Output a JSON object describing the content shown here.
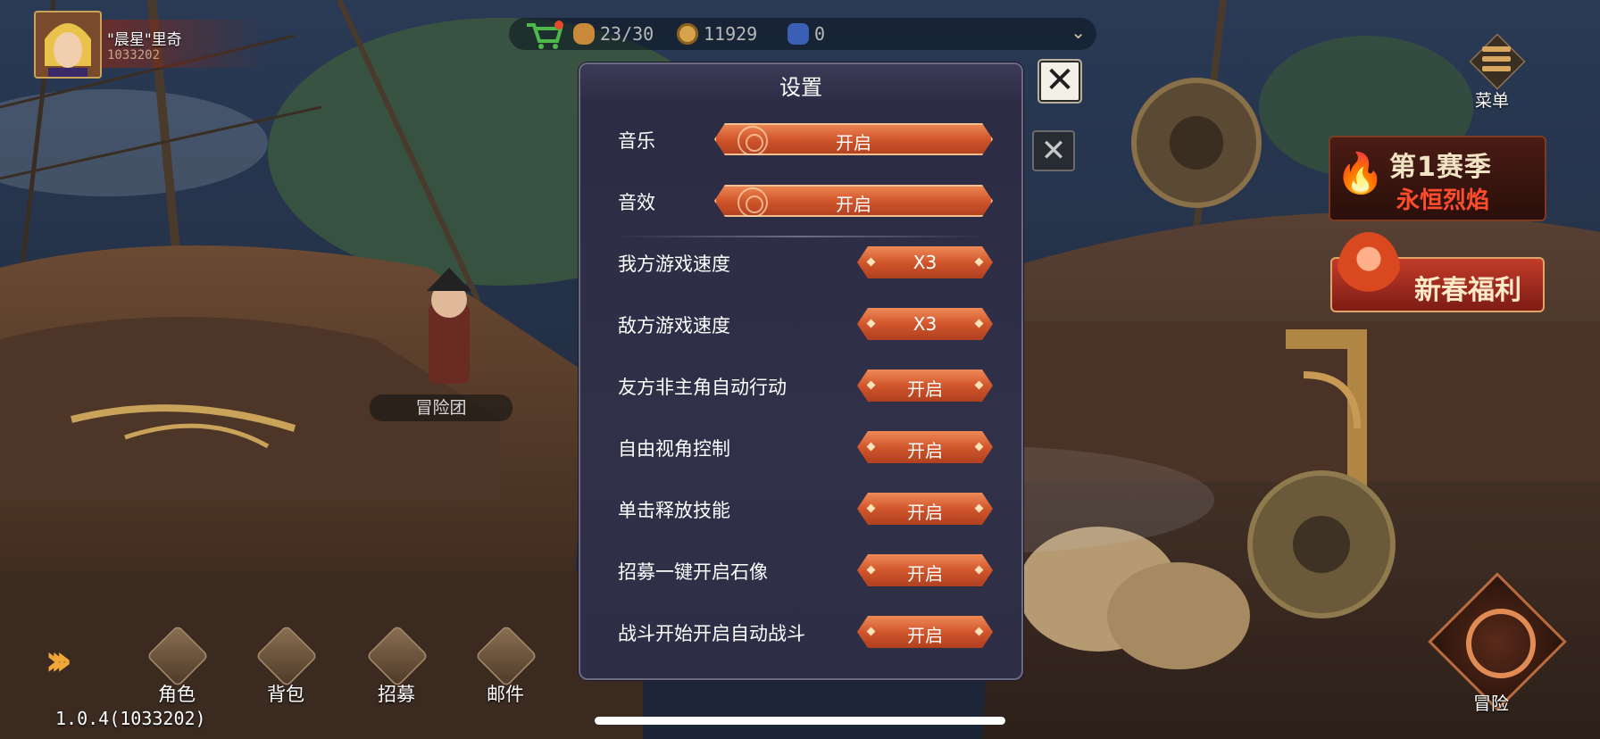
{
  "player": {
    "name": "\"晨星\"里奇",
    "id": "1033202"
  },
  "resources": [
    {
      "name": "stamina",
      "value": "23/30",
      "color": "#c88a3a",
      "icon": "bread-icon"
    },
    {
      "name": "gold",
      "value": "11929",
      "color": "#d6a24a",
      "icon": "coin-icon"
    },
    {
      "name": "gem",
      "value": "0",
      "color": "#3a5fb5",
      "icon": "gem-icon"
    }
  ],
  "menu": {
    "label": "菜单"
  },
  "season_banner": {
    "line1": "第1赛季",
    "line2": "永恒烈焰"
  },
  "new_year_banner": {
    "label": "新春福利"
  },
  "adventure": {
    "label": "冒险"
  },
  "adventure_team": {
    "label": "冒险团"
  },
  "bottom_nav": [
    {
      "label": "角色",
      "icon": "character-icon"
    },
    {
      "label": "背包",
      "icon": "backpack-icon"
    },
    {
      "label": "招募",
      "icon": "recruit-icon"
    },
    {
      "label": "邮件",
      "icon": "mail-icon"
    }
  ],
  "version": "1.0.4(1033202)",
  "settings": {
    "title": "设置",
    "audio": [
      {
        "label": "音乐",
        "value": "开启"
      },
      {
        "label": "音效",
        "value": "开启"
      }
    ],
    "options": [
      {
        "label": "我方游戏速度",
        "value": "X3"
      },
      {
        "label": "敌方游戏速度",
        "value": "X3"
      },
      {
        "label": "友方非主角自动行动",
        "value": "开启"
      },
      {
        "label": "自由视角控制",
        "value": "开启"
      },
      {
        "label": "单击释放技能",
        "value": "开启"
      },
      {
        "label": "招募一键开启石像",
        "value": "开启"
      },
      {
        "label": "战斗开始开启自动战斗",
        "value": "开启"
      }
    ]
  },
  "colors": {
    "accent": "#d1562c",
    "panel": "#2e2e46",
    "gold": "#d8a861"
  }
}
